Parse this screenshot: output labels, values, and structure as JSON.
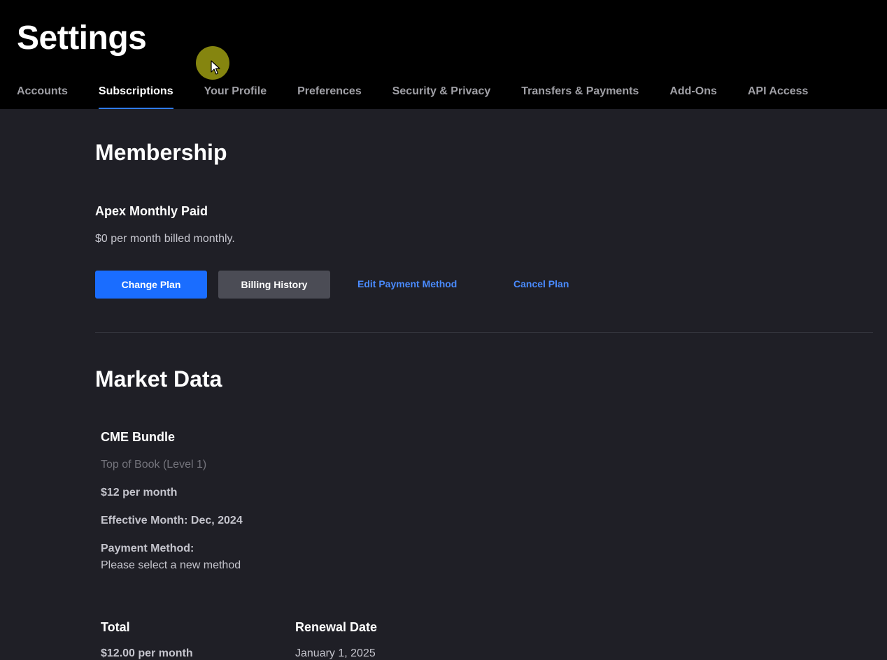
{
  "header": {
    "title": "Settings",
    "tabs": [
      {
        "label": "Accounts",
        "active": false
      },
      {
        "label": "Subscriptions",
        "active": true
      },
      {
        "label": "Your Profile",
        "active": false
      },
      {
        "label": "Preferences",
        "active": false
      },
      {
        "label": "Security & Privacy",
        "active": false
      },
      {
        "label": "Transfers & Payments",
        "active": false
      },
      {
        "label": "Add-Ons",
        "active": false
      },
      {
        "label": "API Access",
        "active": false
      }
    ]
  },
  "membership": {
    "title": "Membership",
    "plan_name": "Apex Monthly Paid",
    "plan_description": "$0 per month billed monthly.",
    "change_plan_label": "Change Plan",
    "billing_history_label": "Billing History",
    "edit_payment_label": "Edit Payment Method",
    "cancel_plan_label": "Cancel Plan"
  },
  "market_data": {
    "title": "Market Data",
    "item": {
      "name": "CME Bundle",
      "level": "Top of Book (Level 1)",
      "price": "$12 per month",
      "effective_month": "Effective Month: Dec, 2024",
      "payment_method_label": "Payment Method:",
      "payment_method_value": "Please select a new method"
    },
    "total_label": "Total",
    "total_value": "$12.00 per month",
    "renewal_label": "Renewal Date",
    "renewal_value": "January 1, 2025"
  },
  "colors": {
    "accent": "#1a6dff",
    "link": "#4a8bff",
    "background": "#1f1f26",
    "header_background": "#000000"
  }
}
